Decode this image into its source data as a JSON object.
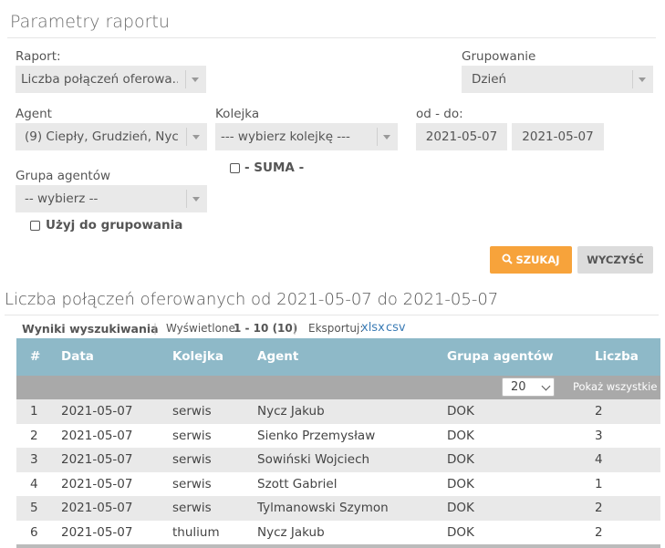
{
  "page": {
    "title": "Parametry raportu"
  },
  "form": {
    "raport": {
      "label": "Raport:",
      "value": "Liczba połączeń oferowa..."
    },
    "grupowanie": {
      "label": "Grupowanie",
      "value": "Dzień"
    },
    "agent": {
      "label": "Agent",
      "value": "(9) Ciepły, Grudzień, Nyc..."
    },
    "kolejka": {
      "label": "Kolejka",
      "value": "--- wybierz kolejkę ---"
    },
    "daterange": {
      "label": "od - do:",
      "from": "2021-05-07",
      "to": "2021-05-07"
    },
    "suma": {
      "label": "- SUMA -"
    },
    "grupa_agentow": {
      "label": "Grupa agentów",
      "value": "-- wybierz --"
    },
    "uzyj_do_grupowania": {
      "label": "Użyj do grupowania"
    },
    "buttons": {
      "search": "SZUKAJ",
      "clear": "WYCZYŚĆ"
    }
  },
  "results": {
    "title": "Liczba połączeń oferowanych od 2021-05-07 do 2021-05-07",
    "meta": {
      "label": "Wyniki wyszukiwania",
      "shown_label": "Wyświetlone:",
      "shown_value": "1 - 10 (10)",
      "export_label": "Eksportuj:",
      "xlsx": "xlsx",
      "csv": "csv"
    },
    "columns": [
      "#",
      "Data",
      "Kolejka",
      "Agent",
      "Grupa agentów",
      "Liczba"
    ],
    "page_size": "20",
    "show_all": "Pokaż wszystkie",
    "rows": [
      [
        "1",
        "2021-05-07",
        "serwis",
        "Nycz Jakub",
        "DOK",
        "2"
      ],
      [
        "2",
        "2021-05-07",
        "serwis",
        "Sienko Przemysław",
        "DOK",
        "3"
      ],
      [
        "3",
        "2021-05-07",
        "serwis",
        "Sowiński Wojciech",
        "DOK",
        "4"
      ],
      [
        "4",
        "2021-05-07",
        "serwis",
        "Szott Gabriel",
        "DOK",
        "1"
      ],
      [
        "5",
        "2021-05-07",
        "serwis",
        "Tylmanowski Szymon",
        "DOK",
        "2"
      ],
      [
        "6",
        "2021-05-07",
        "thulium",
        "Nycz Jakub",
        "DOK",
        "2"
      ]
    ]
  },
  "colors": {
    "accent": "#f7a33b",
    "table_header": "#8eb9c8",
    "link": "#3a7bb5"
  }
}
